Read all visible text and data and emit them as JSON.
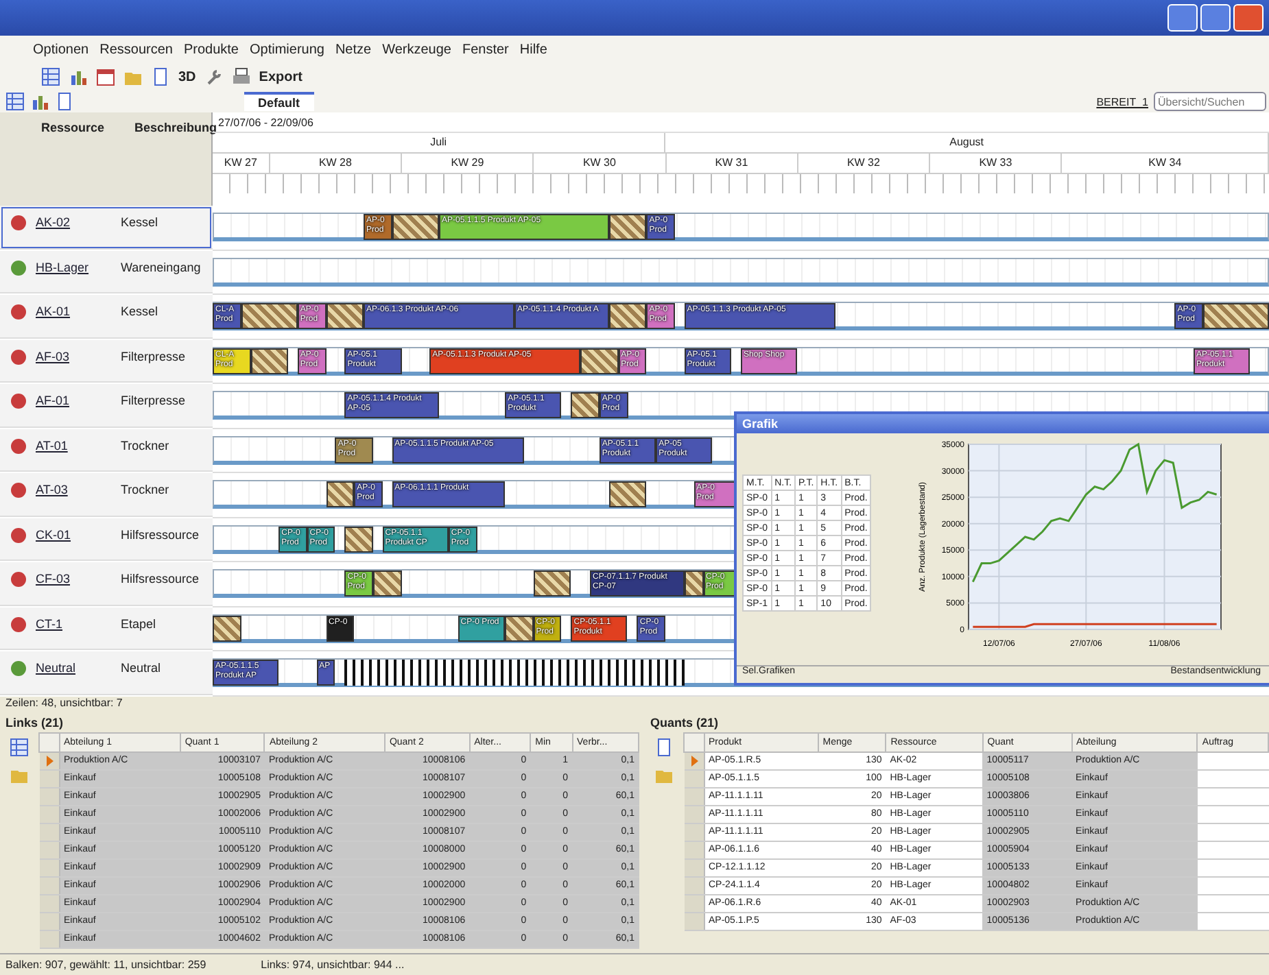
{
  "menu": [
    "Optionen",
    "Ressourcen",
    "Produkte",
    "Optimierung",
    "Netze",
    "Werkzeuge",
    "Fenster",
    "Hilfe"
  ],
  "toolbar": {
    "three_d": "3D",
    "export": "Export"
  },
  "tab": {
    "label": "Default",
    "selected": true
  },
  "search": {
    "label": "BEREIT_1",
    "placeholder": "Übersicht/Suchen"
  },
  "gantt": {
    "range": "27/07/06 - 22/09/06",
    "months": [
      "Juli",
      "August"
    ],
    "weeks": [
      "KW 27",
      "KW 28",
      "KW 29",
      "KW 30",
      "KW 31",
      "KW 32",
      "KW 33",
      "KW 34"
    ],
    "columns": [
      "Ressource",
      "Beschreibung"
    ],
    "rows": [
      {
        "name": "AK-02",
        "description": "Kessel",
        "color": "#c83c3c",
        "selected": true,
        "bars": [
          {
            "label": "AP-0 Prod",
            "kind": "solid",
            "color": "#b06a2a"
          },
          {
            "kind": "hatched"
          },
          {
            "label": "AP-05.1.1.5 Produkt AP-05",
            "kind": "solid",
            "color": "#7ac943"
          },
          {
            "kind": "hatched"
          },
          {
            "label": "AP-0 Prod",
            "kind": "solid",
            "color": "#4a55b0"
          }
        ]
      },
      {
        "name": "HB-Lager",
        "description": "Wareneingang",
        "color": "#5a9a3a",
        "selected": false,
        "bars": []
      },
      {
        "name": "AK-01",
        "description": "Kessel",
        "color": "#c83c3c",
        "selected": false,
        "bars": [
          {
            "label": "CL-A Prod",
            "kind": "solid",
            "color": "#4a55b0"
          },
          {
            "kind": "hatched"
          },
          {
            "label": "AP-0 Prod",
            "kind": "solid",
            "color": "#d070c0"
          },
          {
            "kind": "hatched"
          },
          {
            "label": "AP-06.1.3 Produkt AP-06",
            "kind": "solid",
            "color": "#4a55b0"
          },
          {
            "label": "AP-05.1.1.4 Produkt A",
            "kind": "solid",
            "color": "#4a55b0"
          },
          {
            "kind": "hatched"
          },
          {
            "label": "AP-0 Prod",
            "kind": "solid",
            "color": "#d070c0"
          },
          {
            "label": "AP-05.1.1.3 Produkt AP-05",
            "kind": "solid",
            "color": "#4a55b0"
          },
          {
            "label": "AP-0 Prod",
            "kind": "solid",
            "color": "#4a55b0"
          },
          {
            "kind": "hatched"
          }
        ]
      },
      {
        "name": "AF-03",
        "description": "Filterpresse",
        "color": "#c83c3c",
        "selected": false,
        "bars": [
          {
            "label": "CL-A Prod",
            "kind": "solid",
            "color": "#e8d820"
          },
          {
            "kind": "hatched"
          },
          {
            "label": "AP-0 Prod",
            "kind": "solid",
            "color": "#d070c0"
          },
          {
            "label": "AP-05.1 Produkt",
            "kind": "solid",
            "color": "#4a55b0"
          },
          {
            "label": "AP-05.1.1.3 Produkt AP-05",
            "kind": "solid",
            "color": "#e04020"
          },
          {
            "kind": "hatched"
          },
          {
            "label": "AP-0 Prod",
            "kind": "solid",
            "color": "#d070c0"
          },
          {
            "label": "AP-05.1 Produkt",
            "kind": "solid",
            "color": "#4a55b0"
          },
          {
            "label": "Shop Shop",
            "kind": "solid",
            "color": "#d070c0"
          },
          {
            "label": "AP-05.1.1 Produkt",
            "kind": "solid",
            "color": "#d070c0"
          }
        ]
      },
      {
        "name": "AF-01",
        "description": "Filterpresse",
        "color": "#c83c3c",
        "selected": false,
        "bars": [
          {
            "label": "AP-05.1.1.4 Produkt AP-05",
            "kind": "solid",
            "color": "#4a55b0"
          },
          {
            "label": "AP-05.1.1 Produkt",
            "kind": "solid",
            "color": "#4a55b0"
          },
          {
            "kind": "hatched"
          },
          {
            "label": "AP-0 Prod",
            "kind": "solid",
            "color": "#4a55b0"
          }
        ]
      },
      {
        "name": "AT-01",
        "description": "Trockner",
        "color": "#c83c3c",
        "selected": false,
        "bars": [
          {
            "label": "AP-0 Prod",
            "kind": "solid",
            "color": "#a08a50"
          },
          {
            "label": "AP-05.1.1.5 Produkt AP-05",
            "kind": "solid",
            "color": "#4a55b0"
          },
          {
            "label": "AP-05.1.1 Produkt",
            "kind": "solid",
            "color": "#4a55b0"
          },
          {
            "label": "AP-05 Produkt",
            "kind": "solid",
            "color": "#4a55b0"
          }
        ]
      },
      {
        "name": "AT-03",
        "description": "Trockner",
        "color": "#c83c3c",
        "selected": false,
        "bars": [
          {
            "kind": "hatched"
          },
          {
            "label": "AP-0 Prod",
            "kind": "solid",
            "color": "#4a55b0"
          },
          {
            "label": "AP-06.1.1.1 Produkt",
            "kind": "solid",
            "color": "#4a55b0"
          },
          {
            "kind": "hatched"
          },
          {
            "label": "AP-0 Prod",
            "kind": "solid",
            "color": "#d070c0"
          }
        ]
      },
      {
        "name": "CK-01",
        "description": "Hilfsressource",
        "color": "#c83c3c",
        "selected": false,
        "bars": [
          {
            "label": "CP-0 Prod",
            "kind": "solid",
            "color": "#30a0a0"
          },
          {
            "label": "CP-0 Prod",
            "kind": "solid",
            "color": "#30a0a0"
          },
          {
            "kind": "hatched"
          },
          {
            "label": "CP-05.1.1 Produkt CP",
            "kind": "solid",
            "color": "#30a0a0"
          },
          {
            "label": "CP-0 Prod",
            "kind": "solid",
            "color": "#30a0a0"
          }
        ]
      },
      {
        "name": "CF-03",
        "description": "Hilfsressource",
        "color": "#c83c3c",
        "selected": false,
        "bars": [
          {
            "label": "CP-0 Prod",
            "kind": "solid",
            "color": "#7ac943"
          },
          {
            "kind": "hatched"
          },
          {
            "kind": "hatched"
          },
          {
            "label": "CP-07.1.1.7 Produkt CP-07",
            "kind": "solid",
            "color": "#303880"
          },
          {
            "kind": "hatched"
          },
          {
            "label": "CP-0 Prod",
            "kind": "solid",
            "color": "#7ac943"
          }
        ]
      },
      {
        "name": "CT-1",
        "description": "Etapel",
        "color": "#c83c3c",
        "selected": false,
        "bars": [
          {
            "kind": "hatched"
          },
          {
            "label": "CP-0",
            "kind": "solid",
            "color": "#202020"
          },
          {
            "label": "CP-0 Prod",
            "kind": "solid",
            "color": "#30a0a0"
          },
          {
            "kind": "hatched"
          },
          {
            "label": "CP-0 Prod",
            "kind": "solid",
            "color": "#c0b010"
          },
          {
            "label": "CP-05.1.1 Produkt",
            "kind": "solid",
            "color": "#e04020"
          },
          {
            "label": "CP-0 Prod",
            "kind": "solid",
            "color": "#4a55b0"
          }
        ]
      },
      {
        "name": "Neutral",
        "description": "Neutral",
        "color": "#5a9a3a",
        "selected": false,
        "bars": [
          {
            "label": "AP-05.1.1.5 Produkt AP",
            "kind": "solid",
            "color": "#4a55b0"
          },
          {
            "label": "AP",
            "kind": "solid",
            "color": "#4a55b0"
          },
          {
            "kind": "striped"
          }
        ]
      }
    ],
    "footer": "Zeilen: 48, unsichtbar: 7"
  },
  "graph": {
    "title": "Grafik",
    "columns": [
      "M.T.",
      "N.T.",
      "P.T.",
      "H.T.",
      "B.T."
    ],
    "rows": [
      [
        "SP-0",
        "1",
        "1",
        "3",
        "Prod."
      ],
      [
        "SP-0",
        "1",
        "1",
        "4",
        "Prod."
      ],
      [
        "SP-0",
        "1",
        "1",
        "5",
        "Prod."
      ],
      [
        "SP-0",
        "1",
        "1",
        "6",
        "Prod."
      ],
      [
        "SP-0",
        "1",
        "1",
        "7",
        "Prod."
      ],
      [
        "SP-0",
        "1",
        "1",
        "8",
        "Prod."
      ],
      [
        "SP-0",
        "1",
        "1",
        "9",
        "Prod."
      ],
      [
        "SP-1",
        "1",
        "1",
        "10",
        "Prod."
      ]
    ],
    "status_left": "Sel.Grafiken",
    "status_right": "Bestandsentwicklung",
    "chart_data": {
      "type": "line",
      "grid": true,
      "ylabel": "Anz. Produkte (Lagerbestand)",
      "categories": [
        null,
        null,
        null,
        "12/07/06",
        null,
        null,
        null,
        null,
        null,
        null,
        null,
        null,
        null,
        "27/07/06",
        null,
        null,
        null,
        null,
        null,
        null,
        null,
        null,
        "11/08/06",
        null,
        null,
        null,
        null,
        null,
        null
      ],
      "ylim": [
        0,
        35000
      ],
      "yticks": [
        0,
        5000,
        10000,
        15000,
        20000,
        25000,
        30000,
        35000
      ],
      "series": [
        {
          "color": "#4a9a30",
          "values": [
            9000,
            12500,
            12500,
            13000,
            14500,
            16000,
            17500,
            17000,
            18500,
            20500,
            21000,
            20500,
            23000,
            25500,
            27000,
            26500,
            28000,
            30000,
            34000,
            35000,
            26000,
            30000,
            32000,
            31500,
            23000,
            24000,
            24500,
            26000,
            25500
          ]
        },
        {
          "color": "#d04020",
          "values": [
            500,
            500,
            500,
            500,
            500,
            500,
            500,
            1000,
            1000,
            1000,
            1000,
            1000,
            1000,
            1000,
            1000,
            1000,
            1000,
            1000,
            1000,
            1000,
            1000,
            1000,
            1000,
            1000,
            1000,
            1000,
            1000,
            1000,
            1000
          ]
        }
      ]
    }
  },
  "links": {
    "title": "Links (21)",
    "columns": [
      "Abteilung 1",
      "Quant 1",
      "Abteilung 2",
      "Quant 2",
      "Alter...",
      "Min",
      "Verbr..."
    ],
    "rows": [
      {
        "selected": true,
        "cells": [
          "Produktion A/C",
          "10003107",
          "Produktion A/C",
          "10008106",
          "0",
          "1",
          "0,1"
        ]
      },
      {
        "selected": false,
        "cells": [
          "Einkauf",
          "10005108",
          "Produktion A/C",
          "10008107",
          "0",
          "0",
          "0,1"
        ]
      },
      {
        "selected": false,
        "cells": [
          "Einkauf",
          "10002905",
          "Produktion A/C",
          "10002900",
          "0",
          "0",
          "60,1"
        ]
      },
      {
        "selected": false,
        "cells": [
          "Einkauf",
          "10002006",
          "Produktion A/C",
          "10002900",
          "0",
          "0",
          "0,1"
        ]
      },
      {
        "selected": false,
        "cells": [
          "Einkauf",
          "10005110",
          "Produktion A/C",
          "10008107",
          "0",
          "0",
          "0,1"
        ]
      },
      {
        "selected": false,
        "cells": [
          "Einkauf",
          "10005120",
          "Produktion A/C",
          "10008000",
          "0",
          "0",
          "60,1"
        ]
      },
      {
        "selected": false,
        "cells": [
          "Einkauf",
          "10002909",
          "Produktion A/C",
          "10002900",
          "0",
          "0",
          "0,1"
        ]
      },
      {
        "selected": false,
        "cells": [
          "Einkauf",
          "10002906",
          "Produktion A/C",
          "10002000",
          "0",
          "0",
          "60,1"
        ]
      },
      {
        "selected": false,
        "cells": [
          "Einkauf",
          "10002904",
          "Produktion A/C",
          "10002900",
          "0",
          "0",
          "0,1"
        ]
      },
      {
        "selected": false,
        "cells": [
          "Einkauf",
          "10005102",
          "Produktion A/C",
          "10008106",
          "0",
          "0",
          "0,1"
        ]
      },
      {
        "selected": false,
        "cells": [
          "Einkauf",
          "10004602",
          "Produktion A/C",
          "10008106",
          "0",
          "0",
          "60,1"
        ]
      }
    ]
  },
  "quants": {
    "title": "Quants (21)",
    "columns": [
      "Produkt",
      "Menge",
      "Ressource",
      "Quant",
      "Abteilung",
      "Auftrag"
    ],
    "rows": [
      {
        "selected": true,
        "cells": [
          "AP-05.1.R.5",
          "130",
          "AK-02",
          "10005117",
          "Produktion A/C"
        ]
      },
      {
        "selected": false,
        "cells": [
          "AP-05.1.1.5",
          "100",
          "HB-Lager",
          "10005108",
          "Einkauf"
        ]
      },
      {
        "selected": false,
        "cells": [
          "AP-11.1.1.11",
          "20",
          "HB-Lager",
          "10003806",
          "Einkauf"
        ]
      },
      {
        "selected": false,
        "cells": [
          "AP-11.1.1.11",
          "80",
          "HB-Lager",
          "10005110",
          "Einkauf"
        ]
      },
      {
        "selected": false,
        "cells": [
          "AP-11.1.1.11",
          "20",
          "HB-Lager",
          "10002905",
          "Einkauf"
        ]
      },
      {
        "selected": false,
        "cells": [
          "AP-06.1.1.6",
          "40",
          "HB-Lager",
          "10005904",
          "Einkauf"
        ]
      },
      {
        "selected": false,
        "cells": [
          "CP-12.1.1.12",
          "20",
          "HB-Lager",
          "10005133",
          "Einkauf"
        ]
      },
      {
        "selected": false,
        "cells": [
          "CP-24.1.1.4",
          "20",
          "HB-Lager",
          "10004802",
          "Einkauf"
        ]
      },
      {
        "selected": false,
        "cells": [
          "AP-06.1.R.6",
          "40",
          "AK-01",
          "10002903",
          "Produktion A/C"
        ]
      },
      {
        "selected": false,
        "cells": [
          "AP-05.1.P.5",
          "130",
          "AF-03",
          "10005136",
          "Produktion A/C"
        ]
      }
    ]
  },
  "status_bar": [
    "Balken: 907, gewählt: 11, unsichtbar: 259",
    "Links: 974, unsichtbar: 944 ..."
  ]
}
